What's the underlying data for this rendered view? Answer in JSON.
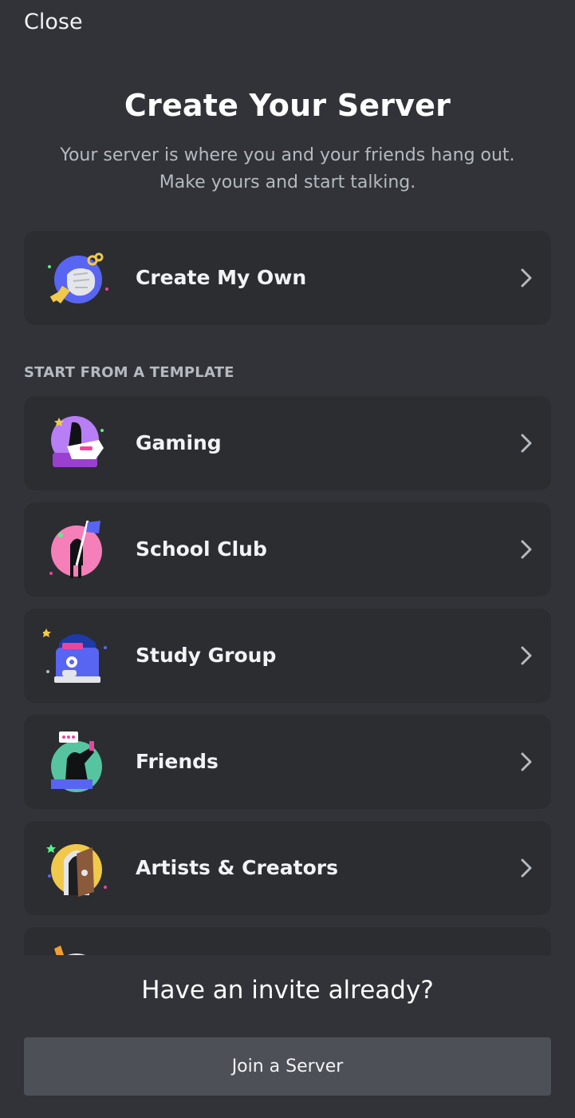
{
  "header": {
    "close_label": "Close",
    "title": "Create Your Server",
    "subtitle_line1": "Your server is where you and your friends hang out.",
    "subtitle_line2": "Make yours and start talking."
  },
  "create_own": {
    "label": "Create My Own",
    "icon": "hand-with-key-icon"
  },
  "templates": {
    "section_title": "START FROM A TEMPLATE",
    "items": [
      {
        "label": "Gaming",
        "icon": "gaming-icon"
      },
      {
        "label": "School Club",
        "icon": "school-club-icon"
      },
      {
        "label": "Study Group",
        "icon": "study-group-icon"
      },
      {
        "label": "Friends",
        "icon": "friends-icon"
      },
      {
        "label": "Artists & Creators",
        "icon": "artists-creators-icon"
      }
    ]
  },
  "footer": {
    "invite_heading": "Have an invite already?",
    "join_label": "Join a Server"
  },
  "colors": {
    "background": "#313338",
    "card": "#2b2d31",
    "button": "#4e5058",
    "muted_text": "#b5bac1"
  }
}
